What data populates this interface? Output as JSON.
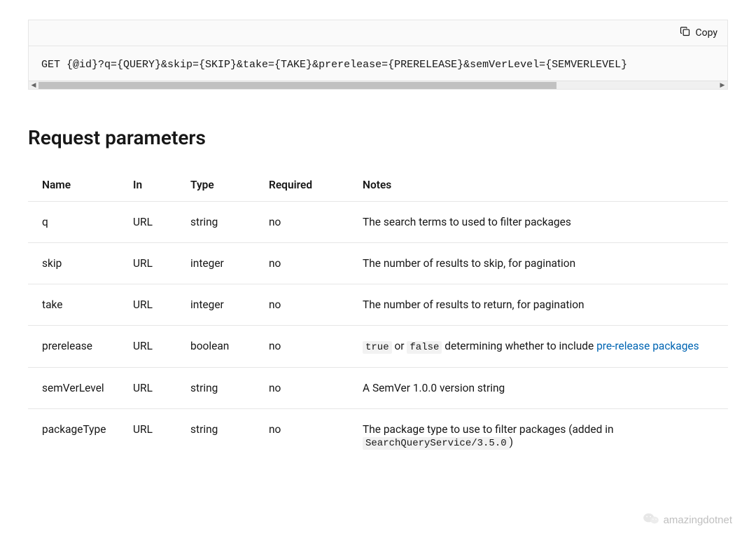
{
  "codeBlock": {
    "copyLabel": "Copy",
    "content": "GET {@id}?q={QUERY}&skip={SKIP}&take={TAKE}&prerelease={PRERELEASE}&semVerLevel={SEMVERLEVEL}"
  },
  "sectionTitle": "Request parameters",
  "table": {
    "headers": {
      "name": "Name",
      "in": "In",
      "type": "Type",
      "required": "Required",
      "notes": "Notes"
    },
    "rows": [
      {
        "name": "q",
        "in": "URL",
        "type": "string",
        "required": "no",
        "notes": "The search terms to used to filter packages"
      },
      {
        "name": "skip",
        "in": "URL",
        "type": "integer",
        "required": "no",
        "notes": "The number of results to skip, for pagination"
      },
      {
        "name": "take",
        "in": "URL",
        "type": "integer",
        "required": "no",
        "notes": "The number of results to return, for pagination"
      },
      {
        "name": "prerelease",
        "in": "URL",
        "type": "boolean",
        "required": "no",
        "notes_parts": {
          "code1": "true",
          "mid1": " or ",
          "code2": "false",
          "mid2": " determining whether to include ",
          "link": "pre-release packages"
        }
      },
      {
        "name": "semVerLevel",
        "in": "URL",
        "type": "string",
        "required": "no",
        "notes": "A SemVer 1.0.0 version string"
      },
      {
        "name": "packageType",
        "in": "URL",
        "type": "string",
        "required": "no",
        "notes_parts": {
          "pre": "The package type to use to filter packages (added in ",
          "code1": "SearchQueryService/3.5.0",
          "post": ")"
        }
      }
    ]
  },
  "watermark": "amazingdotnet"
}
